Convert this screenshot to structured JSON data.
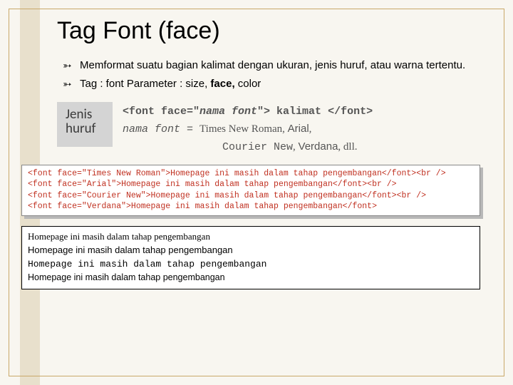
{
  "title": "Tag Font (face)",
  "bullets": [
    "Memformat suatu bagian kalimat dengan ukuran, jenis huruf, atau warna tertentu.",
    "Tag : font Parameter : size, face, color"
  ],
  "bullets_bold_frag": "face,",
  "jenis_label": {
    "line1": "Jenis",
    "line2": "huruf"
  },
  "syntax": {
    "line1_pre": "<font face=\"",
    "line1_italic": "nama font",
    "line1_post": "\"> kalimat </font>",
    "line2_italic": "nama font",
    "line2_eq": " = ",
    "fonts_tnr": "Times New Roman",
    "fonts_arial": "Arial",
    "fonts_cn": "Courier New",
    "fonts_verdana": "Verdana",
    "fonts_suffix": ", dll."
  },
  "code_lines": [
    "<font face=\"Times New Roman\">Homepage ini masih dalam tahap pengembangan</font><br />",
    "<font face=\"Arial\">Homepage ini masih dalam tahap pengembangan</font><br />",
    "<font face=\"Courier New\">Homepage ini masih dalam tahap pengembangan</font><br />",
    "<font face=\"Verdana\">Homepage ini masih dalam tahap pengembangan</font>"
  ],
  "output_lines": [
    "Homepage ini masih dalam tahap pengembangan",
    "Homepage ini masih dalam tahap pengembangan",
    "Homepage ini masih dalam tahap pengembangan",
    "Homepage ini masih dalam tahap pengembangan"
  ]
}
